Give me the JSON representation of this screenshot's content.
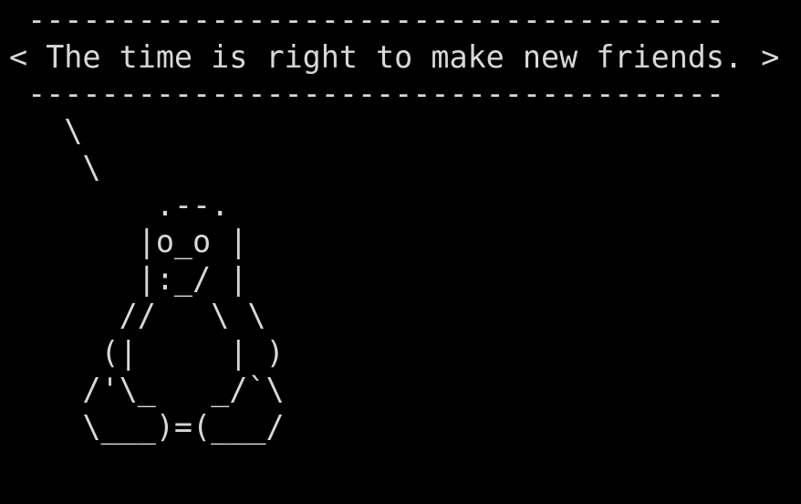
{
  "terminal": {
    "lines": [
      " --------------------------------------",
      "< The time is right to make new friends. >",
      " --------------------------------------",
      "   \\",
      "    \\",
      "        .--.",
      "       |o_o |",
      "       |:_/ |",
      "      //   \\ \\",
      "     (|     | )",
      "    /'\\_   _/`\\",
      "    \\___)=(___/"
    ]
  }
}
